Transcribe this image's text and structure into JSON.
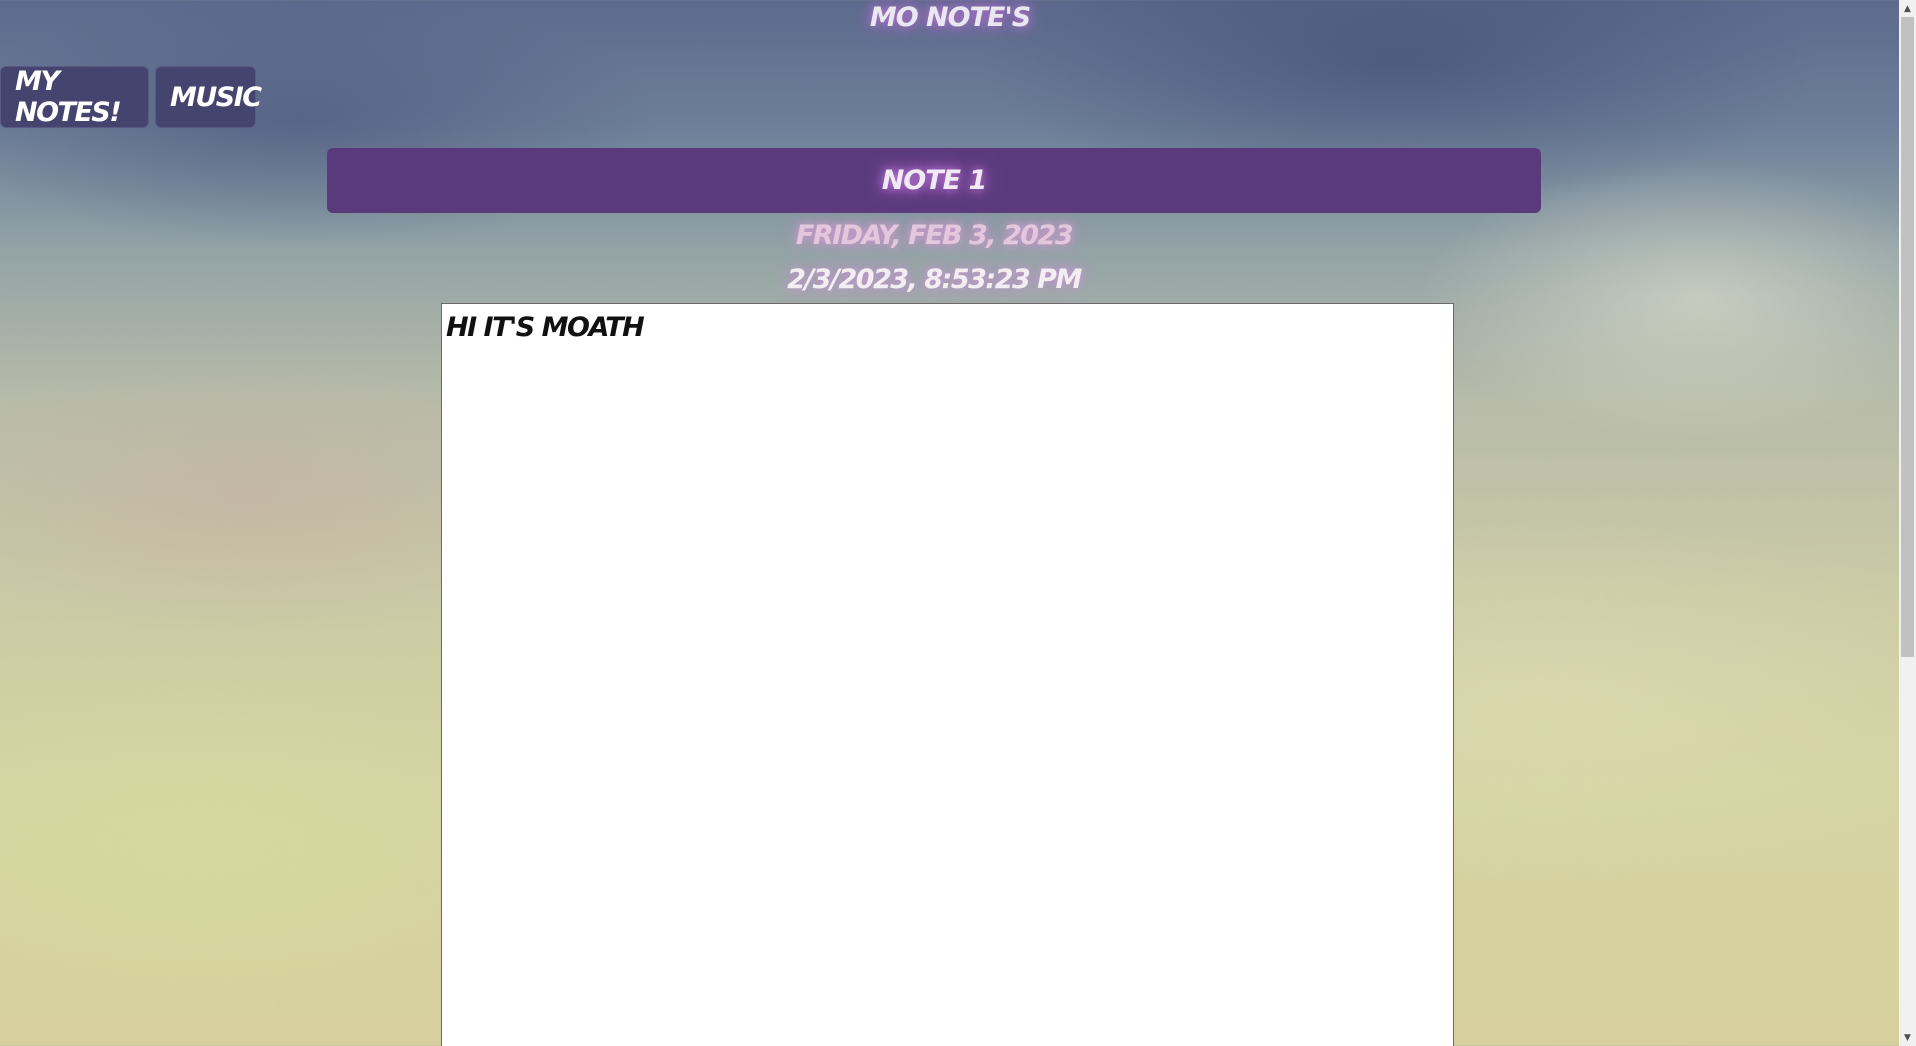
{
  "app": {
    "title": "Mo Note's"
  },
  "nav": {
    "items": [
      {
        "label": "My Notes!"
      },
      {
        "label": "Music"
      }
    ]
  },
  "note": {
    "title": "Note 1",
    "date": "Friday, Feb 3, 2023",
    "timestamp": "2/3/2023, 8:53:23 PM",
    "body": "hi it's  moath"
  },
  "scrollbar": {
    "up_icon": "▲",
    "down_icon": "▼"
  }
}
